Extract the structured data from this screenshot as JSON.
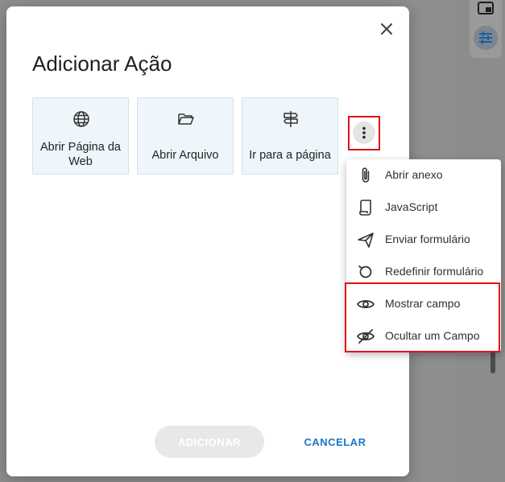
{
  "dialog": {
    "title": "Adicionar Ação",
    "close_icon": "close-icon",
    "cards": [
      {
        "label": "Abrir Página da Web",
        "icon": "globe-icon"
      },
      {
        "label": "Abrir Arquivo",
        "icon": "folder-open-icon"
      },
      {
        "label": "Ir para a página",
        "icon": "signpost-icon"
      }
    ],
    "more_icon": "more-vertical-icon",
    "add_label": "ADICIONAR",
    "cancel_label": "CANCELAR"
  },
  "menu": {
    "items": [
      {
        "label": "Abrir anexo",
        "icon": "paperclip-icon"
      },
      {
        "label": "JavaScript",
        "icon": "script-icon"
      },
      {
        "label": "Enviar formulário",
        "icon": "send-icon"
      },
      {
        "label": "Redefinir formulário",
        "icon": "reset-icon"
      },
      {
        "label": "Mostrar campo",
        "icon": "eye-icon"
      },
      {
        "label": "Ocultar um Campo",
        "icon": "eye-off-icon"
      }
    ]
  },
  "colors": {
    "accent": "#1a77c9",
    "highlight": "#e0121a",
    "card_bg": "#eef6fb"
  }
}
